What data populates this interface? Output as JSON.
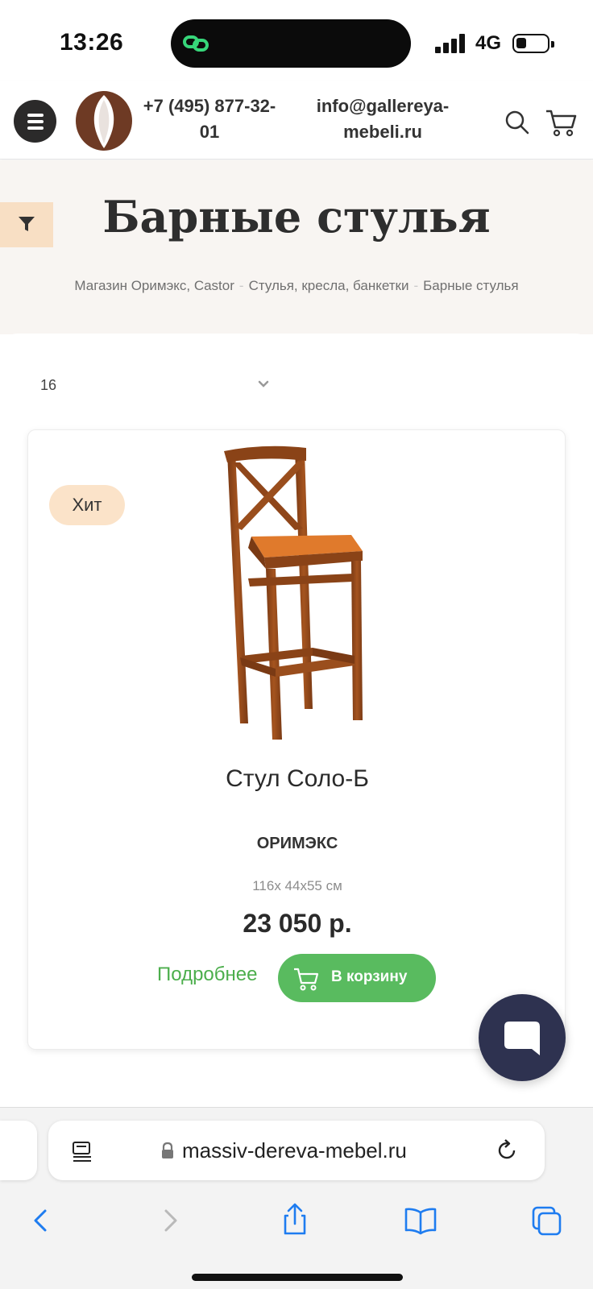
{
  "status_bar": {
    "time": "13:26",
    "network": "4G"
  },
  "header": {
    "phone": "+7 (495) 877-32-01",
    "email": "info@gallereya-mebeli.ru"
  },
  "page": {
    "title": "Барные стулья",
    "breadcrumb": [
      "Магазин Оримэкс, Castor",
      "Стулья, кресла, банкетки",
      "Барные стулья"
    ]
  },
  "sort": {
    "value": "16"
  },
  "product": {
    "badge": "Хит",
    "name": "Стул Соло-Б",
    "brand": "ОРИМЭКС",
    "dimensions": "116х 44х55 см",
    "price": "23 050 р.",
    "more_label": "Подробнее",
    "cart_label": "В корзину"
  },
  "browser": {
    "url": "massiv-dereva-mebel.ru"
  },
  "colors": {
    "accent_green": "#59bb5f",
    "badge_bg": "#fbe3c9",
    "filter_bg": "#f8dfc4",
    "chat_bg": "#2e3250"
  },
  "icons": [
    "menu-icon",
    "logo",
    "search-icon",
    "cart-icon",
    "filter-icon",
    "chevron-down-icon",
    "chat-icon",
    "reader-icon",
    "lock-icon",
    "reload-icon",
    "back-icon",
    "forward-icon",
    "share-icon",
    "bookmarks-icon",
    "tabs-icon"
  ]
}
